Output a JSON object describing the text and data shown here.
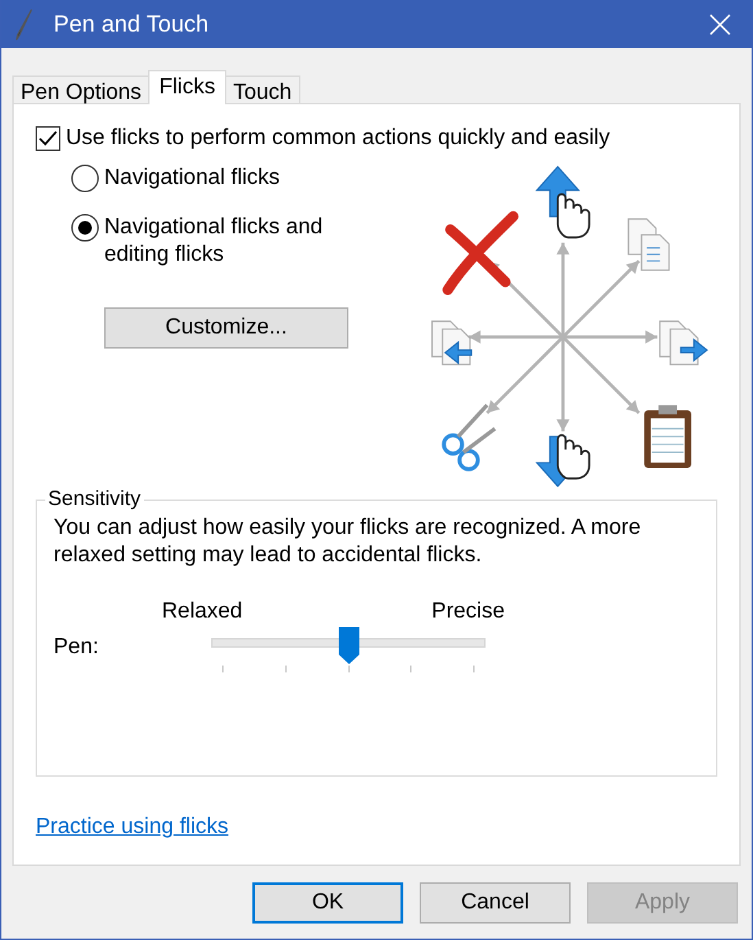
{
  "window": {
    "title": "Pen and Touch"
  },
  "tabs": [
    {
      "label": "Pen Options",
      "selected": false
    },
    {
      "label": "Flicks",
      "selected": true
    },
    {
      "label": "Touch",
      "selected": false
    }
  ],
  "use_flicks": {
    "label": "Use flicks to perform common actions quickly and easily",
    "checked": true
  },
  "flick_modes": [
    {
      "label": "Navigational flicks",
      "selected": false
    },
    {
      "label": "Navigational flicks and editing flicks",
      "selected": true
    }
  ],
  "customize_button": "Customize...",
  "sensitivity": {
    "title": "Sensitivity",
    "description": "You can adjust how easily your flicks are recognized. A more relaxed setting may lead to accidental flicks.",
    "min_label": "Relaxed",
    "max_label": "Precise",
    "slider_label": "Pen:",
    "level": 0.5
  },
  "practice_link": "Practice using flicks",
  "buttons": [
    {
      "label": "OK",
      "kind": "default",
      "disabled": false
    },
    {
      "label": "Cancel",
      "kind": "normal",
      "disabled": false
    },
    {
      "label": "Apply",
      "kind": "normal",
      "disabled": true
    }
  ]
}
